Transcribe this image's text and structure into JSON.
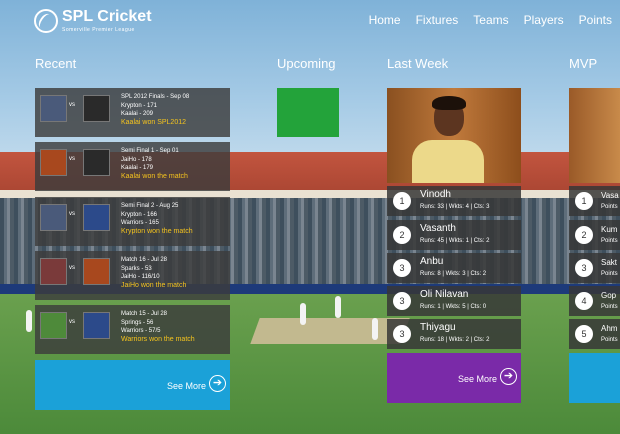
{
  "header": {
    "title": "SPL Cricket",
    "subtitle": "Somerville Premier League",
    "nav": [
      "Home",
      "Fixtures",
      "Teams",
      "Players",
      "Points"
    ]
  },
  "columns": {
    "recent": "Recent",
    "upcoming": "Upcoming",
    "last_week": "Last Week",
    "mvp": "MVP"
  },
  "recent": [
    {
      "title": "SPL 2012 Finals - Sep 08",
      "line1": "Krypton - 171",
      "line2": "Kaalai - 209",
      "result": "Kaalai won SPL2012"
    },
    {
      "title": "Semi Final 1 - Sep 01",
      "line1": "JaiHo - 178",
      "line2": "Kaalai - 179",
      "result": "Kaalai won the match"
    },
    {
      "title": "Semi Final 2 - Aug 25",
      "line1": "Krypton - 166",
      "line2": "Warriors - 165",
      "result": "Krypton won the match"
    },
    {
      "title": "Match 16 - Jul 28",
      "line1": "Sparks - 53",
      "line2": "JaiHo - 116/10",
      "result": "JaiHo won the match"
    },
    {
      "title": "Match 15 - Jul 28",
      "line1": "Springs - 56",
      "line2": "Warriors - 57/5",
      "result": "Warriors won the match"
    }
  ],
  "vs_label": "vs",
  "see_more": "See More",
  "arrow_glyph": "➔",
  "last_week": [
    {
      "rank": "1",
      "name": "Vinodh",
      "stats": "Runs: 33 | Wkts: 4 | Cts: 3"
    },
    {
      "rank": "2",
      "name": "Vasanth",
      "stats": "Runs: 45 | Wkts: 1 | Cts: 2"
    },
    {
      "rank": "3",
      "name": "Anbu",
      "stats": "Runs: 8 | Wkts: 3 | Cts: 2"
    },
    {
      "rank": "3",
      "name": "Oli Nilavan",
      "stats": "Runs: 1 | Wkts: 5 | Cts: 0"
    },
    {
      "rank": "3",
      "name": "Thiyagu",
      "stats": "Runs: 18 | Wkts: 2 | Cts: 2"
    }
  ],
  "mvp": [
    {
      "rank": "1",
      "name": "Vasa",
      "stats": "Points"
    },
    {
      "rank": "2",
      "name": "Kum",
      "stats": "Points"
    },
    {
      "rank": "3",
      "name": "Sakt",
      "stats": "Points"
    },
    {
      "rank": "4",
      "name": "Gop",
      "stats": "Points"
    },
    {
      "rank": "5",
      "name": "Ahm",
      "stats": "Points"
    }
  ],
  "colors": {
    "upcoming_tile": "#23a33a",
    "see_more_blue": "#1ba1d8",
    "see_more_purple": "#7a2aa8",
    "result_gold": "#f4c31e"
  }
}
